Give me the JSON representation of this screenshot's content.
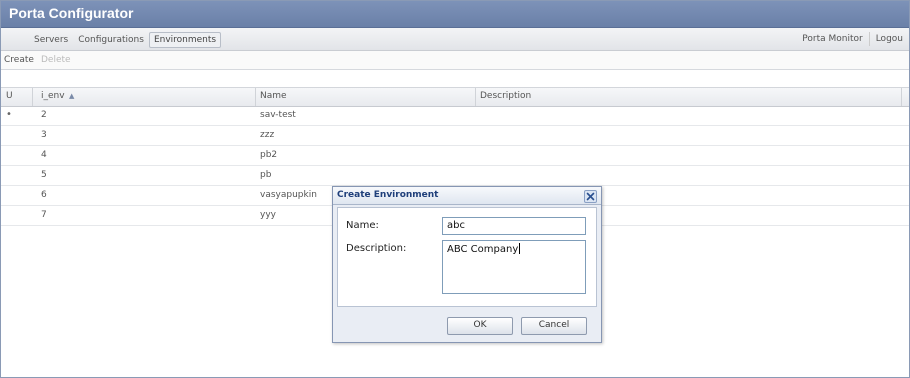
{
  "app": {
    "title": "Porta Configurator"
  },
  "nav": {
    "tabs": [
      "Servers",
      "Configurations",
      "Environments"
    ],
    "active": "Environments",
    "right_links": [
      "Porta Monitor",
      "Logou"
    ]
  },
  "toolbar": {
    "create_label": "Create",
    "delete_label": "Delete"
  },
  "grid": {
    "columns": {
      "u": "U",
      "i_env": "i_env",
      "sort_indicator": "▲",
      "name": "Name",
      "description": "Description"
    },
    "rows": [
      {
        "marker": "•",
        "i_env": "2",
        "name": "sav-test",
        "description": ""
      },
      {
        "marker": "",
        "i_env": "3",
        "name": "zzz",
        "description": ""
      },
      {
        "marker": "",
        "i_env": "4",
        "name": "pb2",
        "description": ""
      },
      {
        "marker": "",
        "i_env": "5",
        "name": "pb",
        "description": ""
      },
      {
        "marker": "",
        "i_env": "6",
        "name": "vasyapupkin",
        "description": ""
      },
      {
        "marker": "",
        "i_env": "7",
        "name": "yyy",
        "description": ""
      }
    ]
  },
  "dialog": {
    "title": "Create Environment",
    "name_label": "Name:",
    "name_value": "abc",
    "description_label": "Description:",
    "description_value": "ABC Company",
    "ok_label": "OK",
    "cancel_label": "Cancel"
  },
  "colors": {
    "titlebar": "#7186ae",
    "dialog_title_text": "#1f3f7a",
    "dialog_bg": "#e9edf4"
  },
  "icons": {
    "dialog_close": "close-icon",
    "sort": "sort-ascending-icon"
  }
}
